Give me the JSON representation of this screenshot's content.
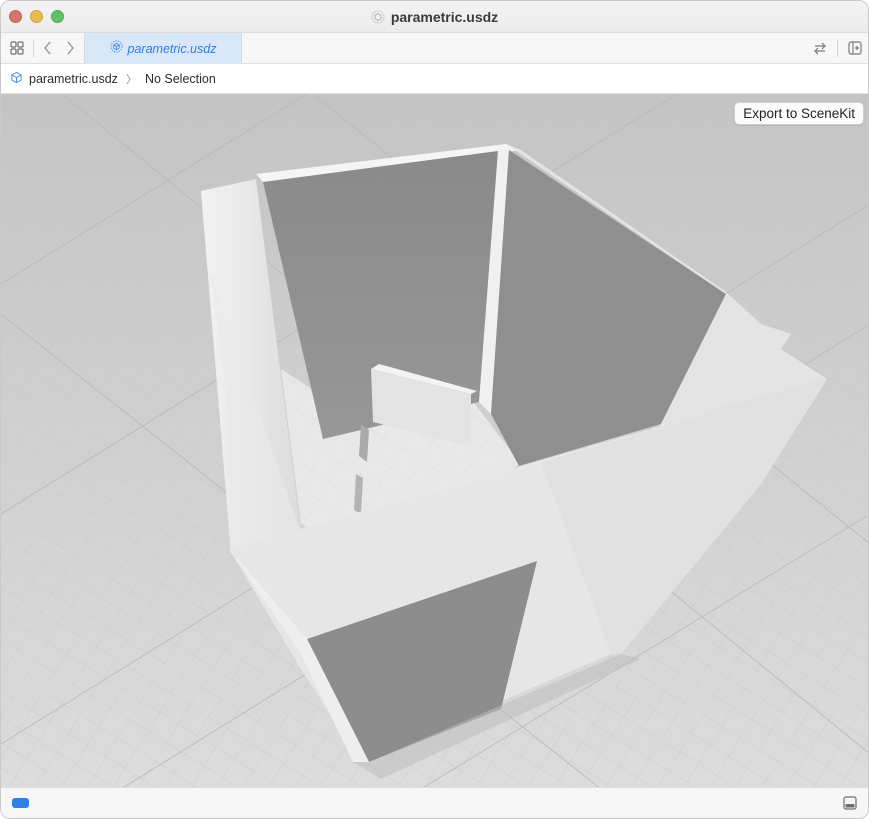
{
  "window": {
    "title": "parametric.usdz",
    "title_icon": "usdz-cube-icon"
  },
  "tabbar": {
    "active_tab_label": "parametric.usdz",
    "icons": [
      "grid-icon",
      "back-chevron-icon",
      "forward-chevron-icon",
      "swap-arrows-icon",
      "add-editor-icon"
    ]
  },
  "breadcrumb": {
    "file": "parametric.usdz",
    "selection": "No Selection"
  },
  "viewport": {
    "export_label": "Export to SceneKit",
    "background_color": "#d2d2d2"
  },
  "statusbar": {
    "left_indicator_color": "#2f7fe6",
    "right_icon": "console-toggle-icon"
  },
  "colors": {
    "accent": "#2f7be0",
    "tab_active_bg": "#d9e8f9",
    "traffic_close": "#d9746c",
    "traffic_min": "#e9bb50",
    "traffic_max": "#5fc16a"
  }
}
